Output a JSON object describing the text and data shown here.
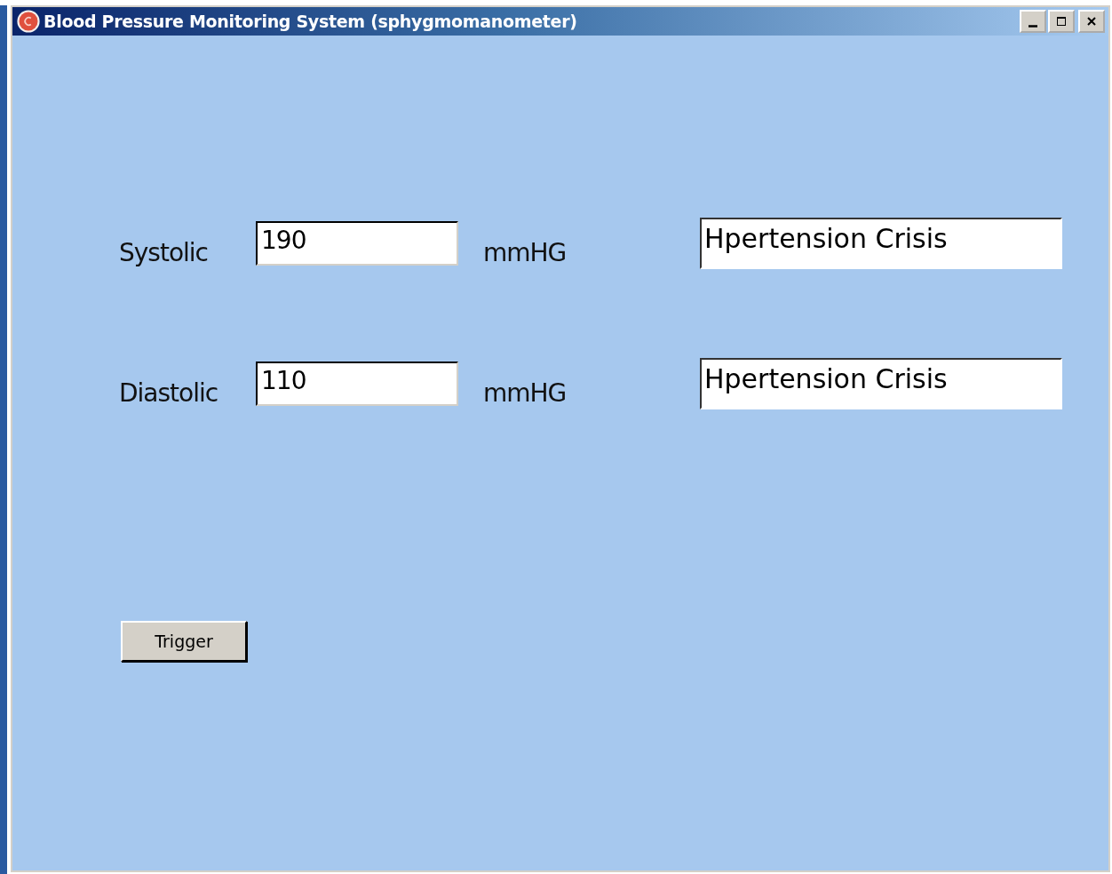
{
  "window": {
    "title": "Blood Pressure Monitoring System (sphygmomanometer)"
  },
  "rows": [
    {
      "label": "Systolic",
      "value": "190",
      "unit": "mmHG",
      "result": "Hpertension Crisis"
    },
    {
      "label": "Diastolic",
      "value": "110",
      "unit": "mmHG",
      "result": "Hpertension Crisis"
    }
  ],
  "buttons": [
    "Trigger"
  ]
}
